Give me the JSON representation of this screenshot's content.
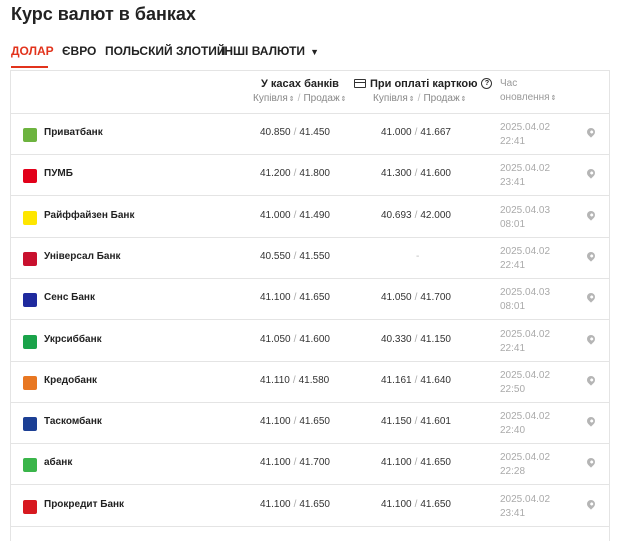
{
  "page_title": "Курс валют в банках",
  "tabs": [
    {
      "label": "ДОЛАР",
      "active": true
    },
    {
      "label": "ЄВРО",
      "active": false
    },
    {
      "label": "ПОЛЬСКИЙ ЗЛОТИЙ",
      "active": false
    },
    {
      "label": "ІНШІ ВАЛЮТИ",
      "active": false,
      "caret": "▼"
    }
  ],
  "table_header": {
    "cash": {
      "label": "У касах банків",
      "buy": "Купівля",
      "sell": "Продаж"
    },
    "card": {
      "label": "При оплаті карткою",
      "help": "?",
      "buy": "Купівля",
      "sell": "Продаж"
    },
    "time": {
      "line1": "Час",
      "line2": "оновлення"
    },
    "sort_glyph": "⇕",
    "separator": "/"
  },
  "rates_separator": "/",
  "banks": [
    {
      "name": "Приватбанк",
      "logo_color": "#6db33f",
      "cash_buy": "40.850",
      "cash_sell": "41.450",
      "card_buy": "41.000",
      "card_sell": "41.667",
      "date": "2025.04.02",
      "time": "22:41"
    },
    {
      "name": "ПУМБ",
      "logo_color": "#e2001a",
      "cash_buy": "41.200",
      "cash_sell": "41.800",
      "card_buy": "41.300",
      "card_sell": "41.600",
      "date": "2025.04.02",
      "time": "23:41"
    },
    {
      "name": "Райффайзен Банк",
      "logo_color": "#fee600",
      "cash_buy": "41.000",
      "cash_sell": "41.490",
      "card_buy": "40.693",
      "card_sell": "42.000",
      "date": "2025.04.03",
      "time": "08:01"
    },
    {
      "name": "Універсал Банк",
      "logo_color": "#c8102e",
      "cash_buy": "40.550",
      "cash_sell": "41.550",
      "card_buy": "",
      "card_sell": "",
      "card_dash": "-",
      "date": "2025.04.02",
      "time": "22:41"
    },
    {
      "name": "Сенс Банк",
      "logo_color": "#1f2a9e",
      "cash_buy": "41.100",
      "cash_sell": "41.650",
      "card_buy": "41.050",
      "card_sell": "41.700",
      "date": "2025.04.03",
      "time": "08:01"
    },
    {
      "name": "Укрсиббанк",
      "logo_color": "#1aa34a",
      "cash_buy": "41.050",
      "cash_sell": "41.600",
      "card_buy": "40.330",
      "card_sell": "41.150",
      "date": "2025.04.02",
      "time": "22:41"
    },
    {
      "name": "Кредобанк",
      "logo_color": "#e87722",
      "cash_buy": "41.110",
      "cash_sell": "41.580",
      "card_buy": "41.161",
      "card_sell": "41.640",
      "date": "2025.04.02",
      "time": "22:50"
    },
    {
      "name": "Таскомбанк",
      "logo_color": "#1c3f94",
      "cash_buy": "41.100",
      "cash_sell": "41.650",
      "card_buy": "41.150",
      "card_sell": "41.601",
      "date": "2025.04.02",
      "time": "22:40"
    },
    {
      "name": "абанк",
      "logo_color": "#3ab54a",
      "cash_buy": "41.100",
      "cash_sell": "41.700",
      "card_buy": "41.100",
      "card_sell": "41.650",
      "date": "2025.04.02",
      "time": "22:28"
    },
    {
      "name": "Прокредит Банк",
      "logo_color": "#d71920",
      "cash_buy": "41.100",
      "cash_sell": "41.650",
      "card_buy": "41.100",
      "card_sell": "41.650",
      "date": "2025.04.02",
      "time": "23:41"
    }
  ],
  "row_icon": "map-pin-icon"
}
